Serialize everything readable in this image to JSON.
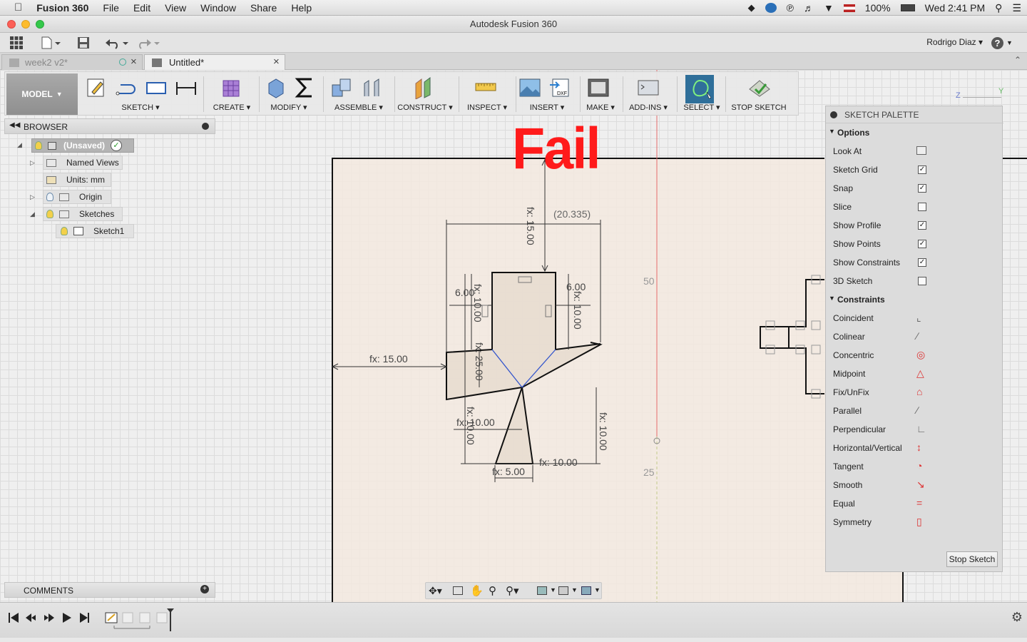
{
  "menubar": {
    "app_name": "Fusion 360",
    "items": [
      "File",
      "Edit",
      "View",
      "Window",
      "Share",
      "Help"
    ],
    "battery": "100%",
    "clock": "Wed 2:41 PM"
  },
  "window": {
    "title": "Autodesk Fusion 360"
  },
  "user": {
    "name": "Rodrigo Diaz"
  },
  "tabs": [
    {
      "label": "week2 v2*"
    },
    {
      "label": "Untitled*"
    }
  ],
  "ribbon": {
    "mode": "MODEL",
    "groups": [
      {
        "label": "SKETCH"
      },
      {
        "label": "CREATE"
      },
      {
        "label": "MODIFY"
      },
      {
        "label": "ASSEMBLE"
      },
      {
        "label": "CONSTRUCT"
      },
      {
        "label": "INSPECT"
      },
      {
        "label": "INSERT"
      },
      {
        "label": "MAKE"
      },
      {
        "label": "ADD-INS"
      },
      {
        "label": "SELECT"
      },
      {
        "label": "STOP SKETCH"
      }
    ]
  },
  "browser": {
    "title": "BROWSER",
    "nodes": [
      {
        "label": "(Unsaved)"
      },
      {
        "label": "Named Views"
      },
      {
        "label": "Units: mm"
      },
      {
        "label": "Origin"
      },
      {
        "label": "Sketches"
      },
      {
        "label": "Sketch1"
      }
    ]
  },
  "comments": {
    "title": "COMMENTS"
  },
  "overlay": {
    "text": "Fail"
  },
  "sketch": {
    "dimensions": {
      "d_top": "fx: 15.00",
      "d_ref": "(20.335)",
      "d_left600": "6.00",
      "d_left1000": "fx: 10.00",
      "d_right600": "6.00",
      "d_right1000": "fx: 10.00",
      "d_fx1500": "fx: 15.00",
      "d_2500": "fx: 25.00",
      "d_low1000h": "fx: 10.00",
      "d_low1000v": "fx: 10.00",
      "d_rightv1000": "fx: 10.00",
      "d_bottom1000": "fx: 10.00",
      "d_bottom500": "fx: 5.00"
    },
    "grid_labels": {
      "g50": "50",
      "g25": "25"
    }
  },
  "palette": {
    "title": "SKETCH PALETTE",
    "options_header": "Options",
    "options": [
      {
        "label": "Look At",
        "type": "icon"
      },
      {
        "label": "Sketch Grid",
        "checked": true
      },
      {
        "label": "Snap",
        "checked": true
      },
      {
        "label": "Slice",
        "checked": false
      },
      {
        "label": "Show Profile",
        "checked": true
      },
      {
        "label": "Show Points",
        "checked": true
      },
      {
        "label": "Show Constraints",
        "checked": true
      },
      {
        "label": "3D Sketch",
        "checked": false
      }
    ],
    "constraints_header": "Constraints",
    "constraints": [
      {
        "label": "Coincident",
        "icon": "coincident-icon"
      },
      {
        "label": "Colinear",
        "icon": "colinear-icon"
      },
      {
        "label": "Concentric",
        "icon": "concentric-icon"
      },
      {
        "label": "Midpoint",
        "icon": "midpoint-icon"
      },
      {
        "label": "Fix/UnFix",
        "icon": "lock-icon"
      },
      {
        "label": "Parallel",
        "icon": "parallel-icon"
      },
      {
        "label": "Perpendicular",
        "icon": "perpendicular-icon"
      },
      {
        "label": "Horizontal/Vertical",
        "icon": "horizontal-vertical-icon"
      },
      {
        "label": "Tangent",
        "icon": "tangent-icon"
      },
      {
        "label": "Smooth",
        "icon": "smooth-icon"
      },
      {
        "label": "Equal",
        "icon": "equal-icon"
      },
      {
        "label": "Symmetry",
        "icon": "symmetry-icon"
      }
    ],
    "stop_label": "Stop Sketch"
  },
  "viewcube": {
    "axis_z": "Z",
    "axis_y": "Y"
  }
}
